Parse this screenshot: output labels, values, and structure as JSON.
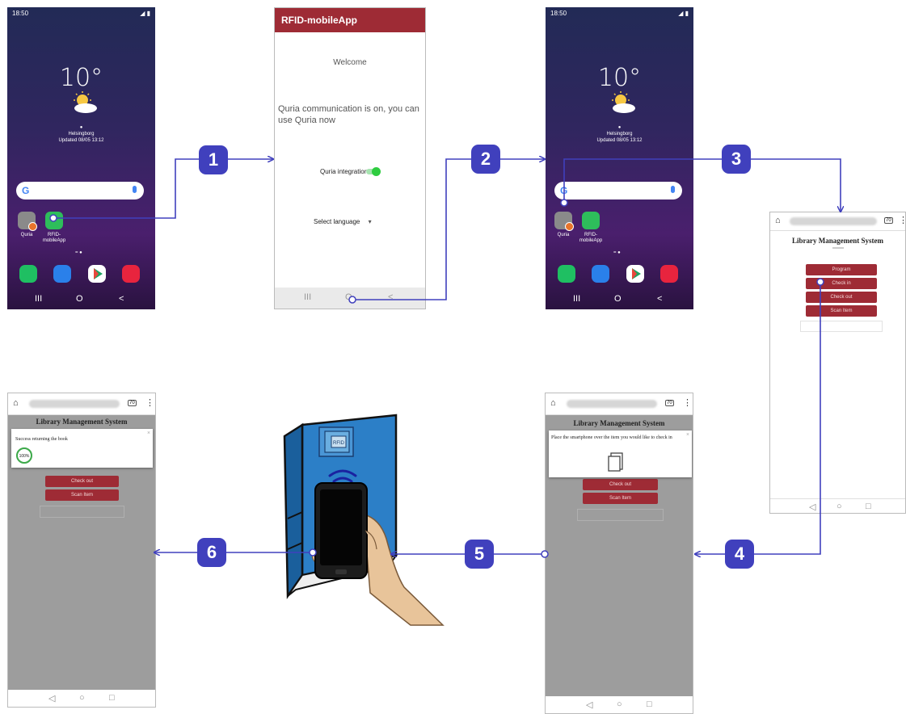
{
  "phone_home": {
    "status_time": "18:50",
    "temperature": "10°",
    "city": "Helsingborg",
    "updated": "Updated 08/05 13:12",
    "search_letter": "G",
    "apps": [
      {
        "label": "Quria"
      },
      {
        "label": "RFID-mobileApp"
      }
    ],
    "nav_keys": [
      "III",
      "O",
      "<"
    ]
  },
  "rfid_app": {
    "title": "RFID-mobileApp",
    "welcome": "Welcome",
    "message": "Quria communication is on, you can use Quria now",
    "integration_label": "Quria integration",
    "integration_on": true,
    "language_label": "Select language",
    "nav_keys": [
      "III",
      "O",
      "<"
    ]
  },
  "library": {
    "title": "Library Management System",
    "buttons": [
      "Program",
      "Check in",
      "Check out",
      "Scan Item"
    ],
    "remaining_buttons": [
      "Check out",
      "Scan Item"
    ]
  },
  "checkin_dialog": {
    "text": "Place the smartphone over the item you would like to check in",
    "close": "×"
  },
  "success_dialog": {
    "text": "Success returning the book",
    "progress": "100%",
    "progress_value": 1.0,
    "close": "×"
  },
  "tab_count": "70",
  "browser_nav_keys": [
    "◁",
    "○",
    "□"
  ],
  "illustration": {
    "book_sticker": "RFID"
  },
  "steps": [
    "1",
    "2",
    "3",
    "4",
    "5",
    "6"
  ],
  "colors": {
    "step_badge": "#4040bd",
    "arrow": "#4040bd",
    "button": "#9e2b35",
    "toggle": "#2ecc40"
  }
}
